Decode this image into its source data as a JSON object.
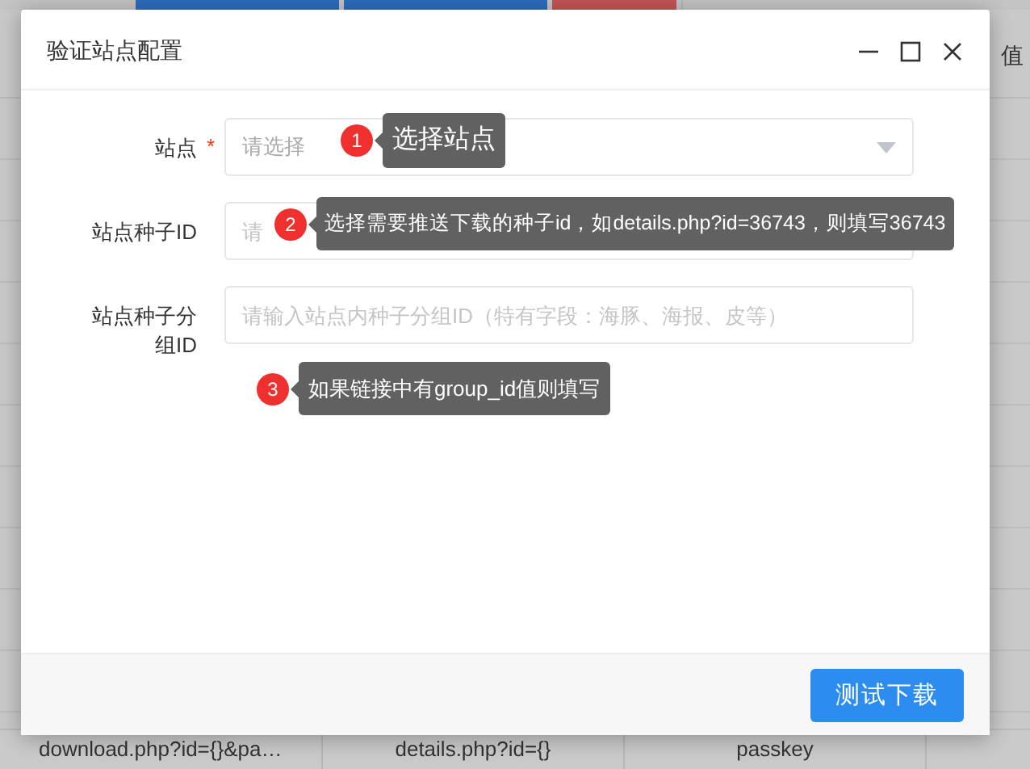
{
  "background": {
    "buttons": [
      {
        "kind": "primary"
      },
      {
        "kind": "primary"
      },
      {
        "kind": "danger"
      },
      {
        "kind": "default"
      }
    ],
    "header_text": "值",
    "row": [
      "download.php?id={}&pa…",
      "details.php?id={}",
      "passkey"
    ]
  },
  "dialog": {
    "title": "验证站点配置",
    "fields": [
      {
        "label": "站点",
        "mark": "*",
        "kind": "select",
        "placeholder": "请选择",
        "tip": {
          "number": "1",
          "text": "选择站点"
        }
      },
      {
        "label": "站点种子ID",
        "kind": "input",
        "placeholder": "请",
        "tip": {
          "number": "2",
          "text": "选择需要推送下载的种子id，如details.php?id=36743，则填写36743"
        }
      },
      {
        "label": "站点种子分组ID",
        "kind": "input",
        "placeholder": "请输入站点内种子分组ID（特有字段：海豚、海报、皮等）",
        "tip": {
          "number": "3",
          "text": "如果链接中有group_id值则填写"
        }
      }
    ],
    "button": "测试下载"
  }
}
